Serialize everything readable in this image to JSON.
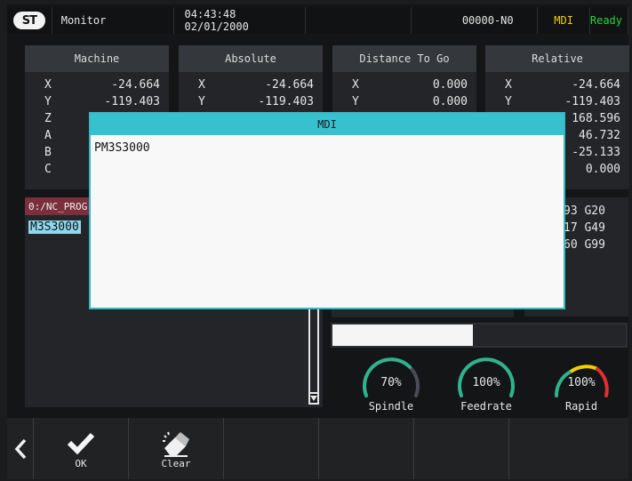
{
  "header": {
    "logo": "ST",
    "title": "Monitor",
    "datetime": "04:43:48 02/01/2000",
    "program_number": "00000-N0",
    "mode": "MDI",
    "status": "Ready"
  },
  "panels": [
    {
      "title": "Machine",
      "rows": [
        {
          "axis": "X",
          "value": "-24.664"
        },
        {
          "axis": "Y",
          "value": "-119.403"
        },
        {
          "axis": "Z",
          "value": ""
        },
        {
          "axis": "A",
          "value": ""
        },
        {
          "axis": "B",
          "value": ""
        },
        {
          "axis": "C",
          "value": ""
        }
      ]
    },
    {
      "title": "Absolute",
      "rows": [
        {
          "axis": "X",
          "value": "-24.664"
        },
        {
          "axis": "Y",
          "value": "-119.403"
        }
      ]
    },
    {
      "title": "Distance To Go",
      "rows": [
        {
          "axis": "X",
          "value": "0.000"
        },
        {
          "axis": "Y",
          "value": "0.000"
        }
      ]
    },
    {
      "title": "Relative",
      "rows": [
        {
          "axis": "X",
          "value": "-24.664"
        },
        {
          "axis": "Y",
          "value": "-119.403"
        },
        {
          "axis": "Z",
          "value": "168.596"
        },
        {
          "axis": "A",
          "value": "46.732"
        },
        {
          "axis": "B",
          "value": "-25.133"
        },
        {
          "axis": "C",
          "value": "0.000"
        }
      ]
    }
  ],
  "program": {
    "path": "0:/NC_PROG",
    "current_line": "M3S3000"
  },
  "gcodes": [
    "93 G20",
    "17 G49",
    "60 G99"
  ],
  "progress_percent": 48,
  "gauges": [
    {
      "label": "Spindle",
      "value": "70%",
      "level": 0.7,
      "color": "#2fb38a"
    },
    {
      "label": "Feedrate",
      "value": "100%",
      "level": 1.0,
      "color": "#2fb38a"
    },
    {
      "label": "Rapid",
      "value": "100%",
      "level": 1.0,
      "color": "#e03030"
    }
  ],
  "toolbar": {
    "back_icon": "chevron-left-icon",
    "ok_label": "OK",
    "clear_label": "Clear"
  },
  "modal": {
    "title": "MDI",
    "text": "PM3S3000"
  }
}
